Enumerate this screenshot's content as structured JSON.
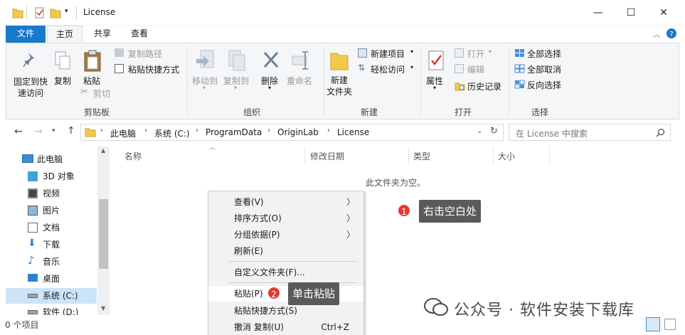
{
  "window": {
    "title": "License"
  },
  "window_controls": {
    "minimize": "—",
    "maximize": "☐",
    "close": "✕"
  },
  "tabs": [
    "文件",
    "主页",
    "共享",
    "查看"
  ],
  "ribbon": {
    "clipboard": {
      "group": "剪贴板",
      "pin_label": "固定到快速访问",
      "pin_line1": "固定到快",
      "pin_line2": "速访问",
      "copy": "复制",
      "paste": "粘贴",
      "copy_path": "复制路径",
      "paste_shortcut": "粘贴快捷方式",
      "cut": "剪切"
    },
    "organize": {
      "group": "组织",
      "move_to": "移动到",
      "copy_to": "复制到",
      "delete": "删除",
      "rename": "重命名"
    },
    "new": {
      "group": "新建",
      "new_folder_line1": "新建",
      "new_folder_line2": "文件夹",
      "new_item": "新建项目",
      "easy_access": "轻松访问"
    },
    "open": {
      "group": "打开",
      "properties": "属性",
      "open": "打开",
      "edit": "编辑",
      "history": "历史记录"
    },
    "select": {
      "group": "选择",
      "select_all": "全部选择",
      "select_none": "全部取消",
      "invert": "反向选择"
    }
  },
  "address": {
    "crumbs": [
      "此电脑",
      "系统 (C:)",
      "ProgramData",
      "OriginLab",
      "License"
    ],
    "search_placeholder": "在 License 中搜索"
  },
  "nav": [
    {
      "label": "此电脑",
      "icon": "pc-icon"
    },
    {
      "label": "3D 对象",
      "icon": "3d-objects-icon"
    },
    {
      "label": "视频",
      "icon": "video-icon"
    },
    {
      "label": "图片",
      "icon": "pictures-icon"
    },
    {
      "label": "文档",
      "icon": "documents-icon"
    },
    {
      "label": "下载",
      "icon": "download-icon"
    },
    {
      "label": "音乐",
      "icon": "music-icon"
    },
    {
      "label": "桌面",
      "icon": "desktop-icon"
    },
    {
      "label": "系统 (C:)",
      "icon": "drive-icon"
    },
    {
      "label": "软件 (D:)",
      "icon": "drive-icon"
    }
  ],
  "columns": [
    "名称",
    "修改日期",
    "类型",
    "大小"
  ],
  "empty_text": "此文件夹为空。",
  "status": {
    "items": "0 个项目"
  },
  "context_menu": {
    "view": "查看(V)",
    "sort": "排序方式(O)",
    "group": "分组依据(P)",
    "refresh": "刷新(E)",
    "customize": "自定义文件夹(F)...",
    "paste": "粘贴(P)",
    "paste_shortcut": "粘贴快捷方式(S)",
    "undo": "撤消 复制(U)",
    "undo_shortcut": "Ctrl+Z"
  },
  "annotations": {
    "step1_badge": "1",
    "step1_text": "右击空白处",
    "step2_badge": "2",
    "step2_text": "单击粘贴"
  },
  "watermark": "公众号 · 软件安装下载库",
  "colors": {
    "accent": "#1979ca",
    "badge": "#e43a32",
    "callout": "#5a5a5a"
  }
}
